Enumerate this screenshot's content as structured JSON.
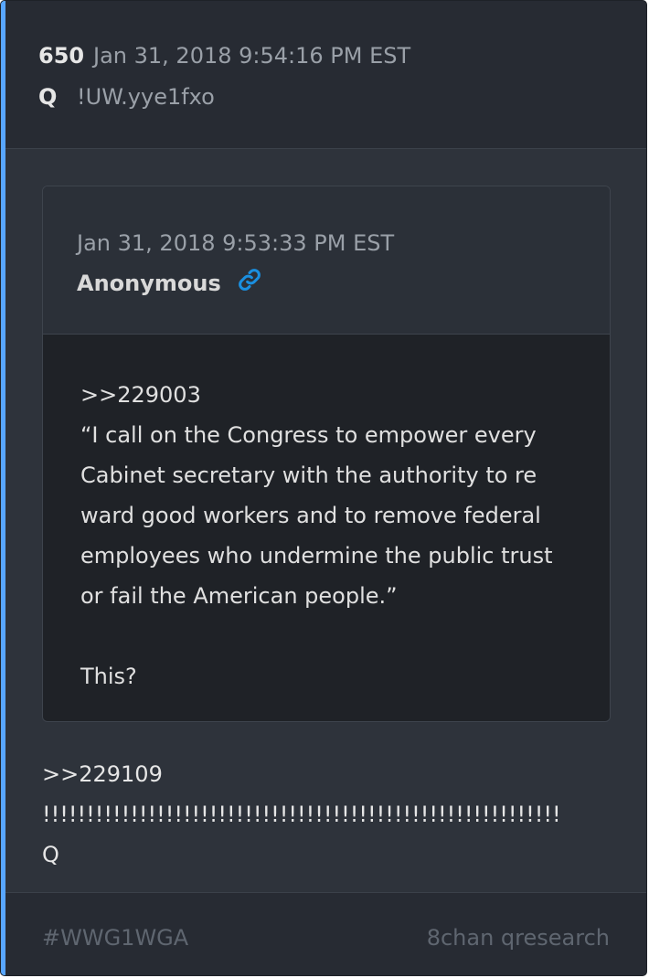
{
  "post": {
    "number": "650",
    "date": "Jan 31, 2018 9:54:16 PM EST",
    "author": "Q",
    "tripcode": "!UW.yye1fxo"
  },
  "quoted_post": {
    "date": "Jan 31, 2018 9:53:33 PM EST",
    "author": "Anonymous",
    "link_icon": "link-icon",
    "text": ">>229003\n“I call on the Congress to empower every Cabinet secretary with the authority to re ward good workers and to remove federal employees who undermine the public trust or fail the American people.”\n\nThis?"
  },
  "body": {
    "text": ">>229109\n!!!!!!!!!!!!!!!!!!!!!!!!!!!!!!!!!!!!!!!!!!!!!!!!!!!!!!!!!!!\nQ"
  },
  "footer": {
    "hashtag": "#WWG1WGA",
    "source": "8chan qresearch"
  },
  "colors": {
    "accent": "#58a6ff",
    "link": "#1a8fe0",
    "card_bg": "#2e333b",
    "quote_body_bg": "#1f2227"
  }
}
